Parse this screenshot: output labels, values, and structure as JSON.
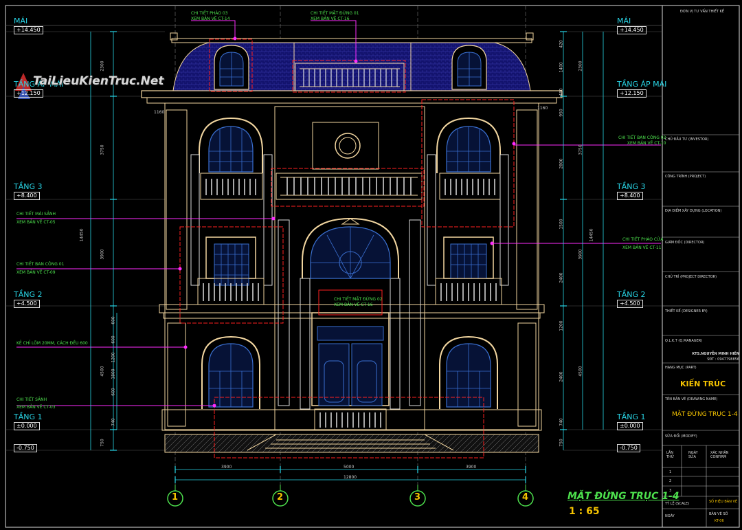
{
  "drawing": {
    "title": "MẶT ĐỨNG TRỤC 1-4",
    "scale": "1 : 65",
    "watermark": "TaiLieuKienTruc.Net"
  },
  "levels_left": [
    {
      "name": "MÁI",
      "value": "+14.450"
    },
    {
      "name": "TẦNG ÁP MÁI",
      "value": "+12.150"
    },
    {
      "name": "TẦNG 3",
      "value": "+8.400"
    },
    {
      "name": "TẦNG 2",
      "value": "+4.500"
    },
    {
      "name": "TẦNG 1",
      "value": "±0.000"
    },
    {
      "name": "",
      "value": "-0.750"
    }
  ],
  "levels_right": [
    {
      "name": "MÁI",
      "value": "+14.450"
    },
    {
      "name": "TẦNG ÁP MÁI",
      "value": "+12.150"
    },
    {
      "name": "TẦNG 3",
      "value": "+8.400"
    },
    {
      "name": "TẦNG 2",
      "value": "+4.500"
    },
    {
      "name": "TẦNG 1",
      "value": "±0.000"
    },
    {
      "name": "",
      "value": "-0.750"
    }
  ],
  "callouts": {
    "phao03": [
      "CHI TIẾT PHÀO 03",
      "XEM BẢN VẼ CT-14"
    ],
    "matdung01": [
      "CHI TIẾT MẶT ĐỨNG 01",
      "XEM BẢN VẼ CT-16"
    ],
    "bancong02": [
      "CHI TIẾT BAN CÔNG 02",
      "XEM BẢN VẼ CT-10"
    ],
    "maisanh": [
      "CHI TIẾT MÁI SẢNH",
      "XEM BẢN VẼ CT-05"
    ],
    "bancong01": [
      "CHI TIẾT BAN CÔNG 01",
      "XEM BẢN VẼ CT-09"
    ],
    "phaocua": [
      "CHI TIẾT PHÀO CỬA",
      "XEM BẢN VẼ CT-11"
    ],
    "kechi": [
      "KẺ CHỈ LÕM 20MM, CÁCH ĐỀU 600"
    ],
    "sanh": [
      "CHI TIẾT SẢNH",
      "XEM BẢN VẼ CT-03"
    ],
    "matdung02": [
      "CHI TIẾT MẶT ĐỨNG 02",
      "XEM BẢN VẼ CT-16"
    ]
  },
  "dims_horizontal": {
    "spans": [
      "3900",
      "5000",
      "3900"
    ],
    "total": "12800",
    "left_overhang": "1160",
    "right_overhang": "1160"
  },
  "dims_left": [
    "2300",
    "3750",
    "3900",
    "4500",
    "750"
  ],
  "dims_left_total": "14450",
  "dims_right_detail": [
    "420",
    "1400",
    "480",
    "950",
    "2800",
    "1500",
    "2400",
    "1200",
    "2400",
    "740",
    "750"
  ],
  "dims_right_main": [
    "2300",
    "3750",
    "3900",
    "4500"
  ],
  "dims_right_total": "14450",
  "dims_center_left": [
    "600",
    "600",
    "1200",
    "1800",
    "600",
    "740"
  ],
  "axes": [
    "1",
    "2",
    "3",
    "4"
  ],
  "title_block": {
    "consultant": "ĐƠN VỊ TƯ VẤN THIẾT KẾ",
    "investor": "CHỦ ĐẦU TƯ (INVESTOR)",
    "project": "CÔNG TRÌNH (PROJECT)",
    "location": "ĐỊA ĐIỂM XÂY DỰNG (LOCATION)",
    "director": "GIÁM ĐỐC (DIRECTOR)",
    "project_director": "CHỦ TRÌ (PROJECT DIRECTOR)",
    "designer": "THIẾT KẾ (DESIGNER BY)",
    "manager": "Q.L.K.T (Q.MANAGER)",
    "architect": "KTS.NGUYỄN MINH HIẾN",
    "phone": "SĐT : 0947798856",
    "part_label": "HẠNG MỤC (PART)",
    "part": "KIẾN TRÚC",
    "drawing_name_label": "TÊN BẢN VẼ (DRAWING NAME)",
    "drawing_name": "MẶT ĐỨNG TRỤC 1-4",
    "modify_label": "SỬA ĐỔI (MODIFY)",
    "rev_headers": [
      "LẦN THỨ",
      "NGÀY SỬA",
      "XÁC NHẬN CONFIRM"
    ],
    "rev_rows": [
      "1",
      "2",
      "3"
    ],
    "scale_label": "TỶ LỆ (SCALE)",
    "sheet_label": "SỐ HIỆU BẢN VẼ",
    "sheet_no": "KT-06",
    "sheet_total_label": "BẢN VẼ SỐ",
    "date_label": "NGÀY"
  },
  "colors": {
    "background": "#000000",
    "outline": "#f2d6a0",
    "roof": "#13136e",
    "window": "#3a6fd0",
    "callout": "#ff2bff",
    "redline": "#ff2020",
    "cyan": "#29d7e8",
    "green": "#4de04d",
    "yellow": "#f5c400"
  }
}
